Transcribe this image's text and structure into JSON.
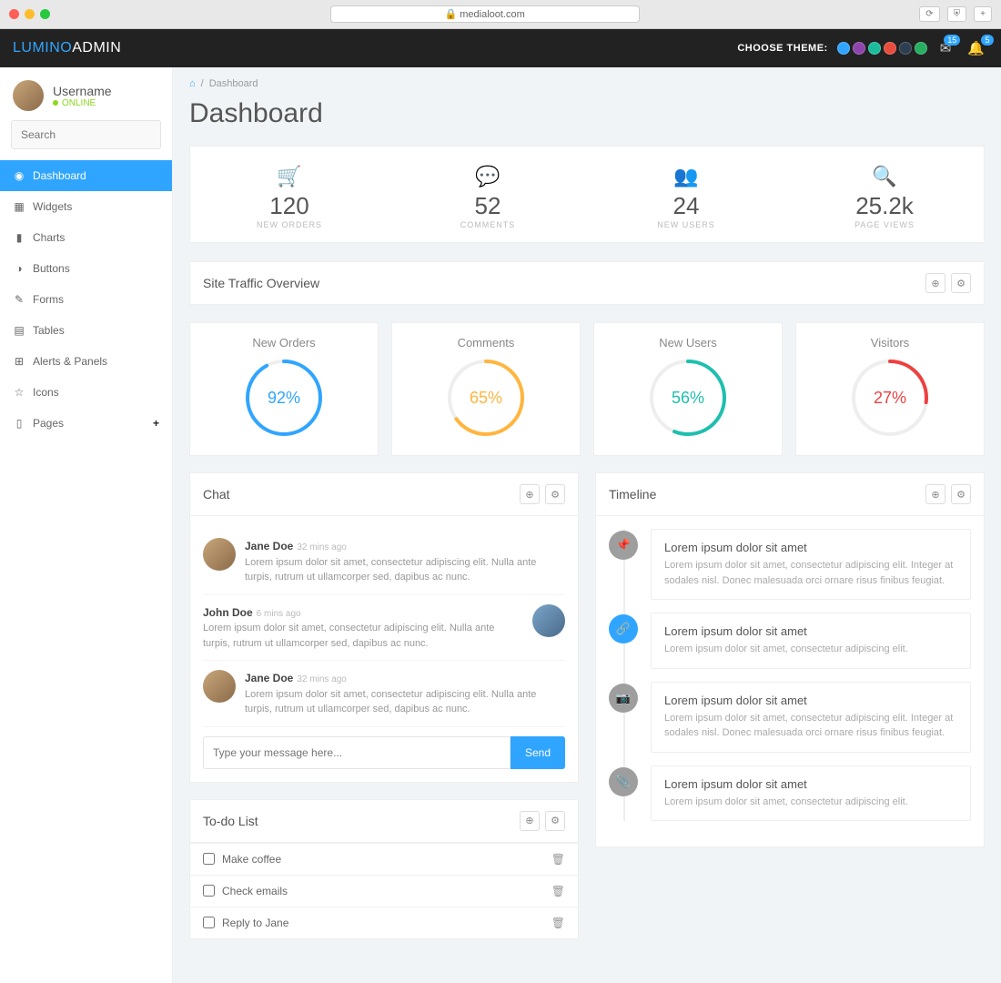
{
  "browser": {
    "url": "medialoot.com"
  },
  "brand": {
    "part1": "LUMINO",
    "part2": "ADMIN"
  },
  "navbar": {
    "theme_label": "CHOOSE THEME:",
    "theme_colors": [
      "#30a5ff",
      "#8e44ad",
      "#1abc9c",
      "#e74c3c",
      "#2c3e50",
      "#27ae60"
    ],
    "mail_badge": "15",
    "bell_badge": "5"
  },
  "profile": {
    "username": "Username",
    "status": "ONLINE"
  },
  "search_placeholder": "Search",
  "sidebar": {
    "items": [
      {
        "label": "Dashboard",
        "icon": "◉",
        "active": true
      },
      {
        "label": "Widgets",
        "icon": "▦"
      },
      {
        "label": "Charts",
        "icon": "▮"
      },
      {
        "label": "Buttons",
        "icon": "◑"
      },
      {
        "label": "Forms",
        "icon": "✎"
      },
      {
        "label": "Tables",
        "icon": "▤"
      },
      {
        "label": "Alerts & Panels",
        "icon": "⊞"
      },
      {
        "label": "Icons",
        "icon": "☆"
      },
      {
        "label": "Pages",
        "icon": "▯",
        "expandable": true
      }
    ]
  },
  "breadcrumb": {
    "home": "⌂",
    "current": "Dashboard"
  },
  "page_title": "Dashboard",
  "stats": [
    {
      "icon": "🛒",
      "color": "#30a5ff",
      "value": "120",
      "label": "NEW ORDERS"
    },
    {
      "icon": "💬",
      "color": "#ffb53e",
      "value": "52",
      "label": "COMMENTS"
    },
    {
      "icon": "👥",
      "color": "#1ebfae",
      "value": "24",
      "label": "NEW USERS"
    },
    {
      "icon": "🔍",
      "color": "#ef4040",
      "value": "25.2k",
      "label": "PAGE VIEWS"
    }
  ],
  "traffic_panel": {
    "title": "Site Traffic Overview"
  },
  "progress": [
    {
      "title": "New Orders",
      "value": 92,
      "color": "#30a5ff"
    },
    {
      "title": "Comments",
      "value": 65,
      "color": "#ffb53e"
    },
    {
      "title": "New Users",
      "value": 56,
      "color": "#1ebfae"
    },
    {
      "title": "Visitors",
      "value": 27,
      "color": "#ef4040"
    }
  ],
  "chat": {
    "title": "Chat",
    "messages": [
      {
        "name": "Jane Doe",
        "time": "32 mins ago",
        "body": "Lorem ipsum dolor sit amet, consectetur adipiscing elit. Nulla ante turpis, rutrum ut ullamcorper sed, dapibus ac nunc.",
        "side": "left"
      },
      {
        "name": "John Doe",
        "time": "6 mins ago",
        "body": "Lorem ipsum dolor sit amet, consectetur adipiscing elit. Nulla ante turpis, rutrum ut ullamcorper sed, dapibus ac nunc.",
        "side": "right"
      },
      {
        "name": "Jane Doe",
        "time": "32 mins ago",
        "body": "Lorem ipsum dolor sit amet, consectetur adipiscing elit. Nulla ante turpis, rutrum ut ullamcorper sed, dapibus ac nunc.",
        "side": "left"
      }
    ],
    "placeholder": "Type your message here...",
    "send_label": "Send"
  },
  "todo": {
    "title": "To-do List",
    "items": [
      {
        "label": "Make coffee"
      },
      {
        "label": "Check emails"
      },
      {
        "label": "Reply to Jane"
      }
    ]
  },
  "timeline": {
    "title": "Timeline",
    "items": [
      {
        "icon": "📌",
        "color": "#9e9e9e",
        "title": "Lorem ipsum dolor sit amet",
        "body": "Lorem ipsum dolor sit amet, consectetur adipiscing elit. Integer at sodales nisl. Donec malesuada orci ornare risus finibus feugiat."
      },
      {
        "icon": "🔗",
        "color": "#30a5ff",
        "title": "Lorem ipsum dolor sit amet",
        "body": "Lorem ipsum dolor sit amet, consectetur adipiscing elit."
      },
      {
        "icon": "📷",
        "color": "#9e9e9e",
        "title": "Lorem ipsum dolor sit amet",
        "body": "Lorem ipsum dolor sit amet, consectetur adipiscing elit. Integer at sodales nisl. Donec malesuada orci ornare risus finibus feugiat."
      },
      {
        "icon": "📎",
        "color": "#9e9e9e",
        "title": "Lorem ipsum dolor sit amet",
        "body": "Lorem ipsum dolor sit amet, consectetur adipiscing elit."
      }
    ]
  }
}
